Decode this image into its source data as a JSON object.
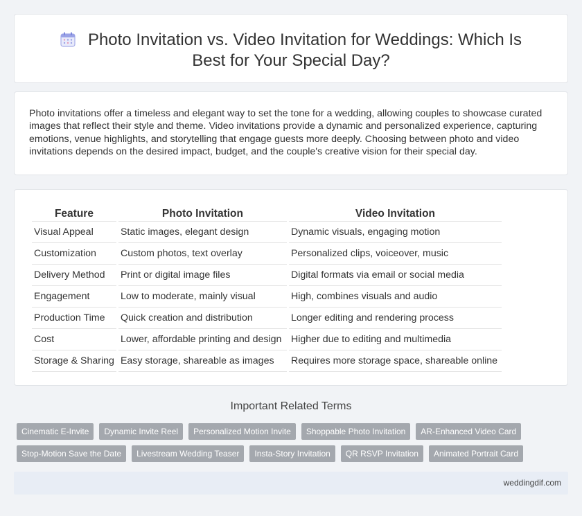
{
  "header": {
    "title": "Photo Invitation vs. Video Invitation for Weddings: Which Is Best for Your Special Day?",
    "icon": "calendar-icon"
  },
  "intro": {
    "text": "Photo invitations offer a timeless and elegant way to set the tone for a wedding, allowing couples to showcase curated images that reflect their style and theme. Video invitations provide a dynamic and personalized experience, capturing emotions, venue highlights, and storytelling that engage guests more deeply. Choosing between photo and video invitations depends on the desired impact, budget, and the couple's creative vision for their special day."
  },
  "comparison": {
    "headers": [
      "Feature",
      "Photo Invitation",
      "Video Invitation"
    ],
    "rows": [
      [
        "Visual Appeal",
        "Static images, elegant design",
        "Dynamic visuals, engaging motion"
      ],
      [
        "Customization",
        "Custom photos, text overlay",
        "Personalized clips, voiceover, music"
      ],
      [
        "Delivery Method",
        "Print or digital image files",
        "Digital formats via email or social media"
      ],
      [
        "Engagement",
        "Low to moderate, mainly visual",
        "High, combines visuals and audio"
      ],
      [
        "Production Time",
        "Quick creation and distribution",
        "Longer editing and rendering process"
      ],
      [
        "Cost",
        "Lower, affordable printing and design",
        "Higher due to editing and multimedia"
      ],
      [
        "Storage & Sharing",
        "Easy storage, shareable as images",
        "Requires more storage space, shareable online"
      ]
    ]
  },
  "related": {
    "heading": "Important Related Terms",
    "tags": [
      "Cinematic E-Invite",
      "Dynamic Invite Reel",
      "Personalized Motion Invite",
      "Shoppable Photo Invitation",
      "AR-Enhanced Video Card",
      "Stop-Motion Save the Date",
      "Livestream Wedding Teaser",
      "Insta-Story Invitation",
      "QR RSVP Invitation",
      "Animated Portrait Card"
    ]
  },
  "footer": {
    "site": "weddingdif.com"
  },
  "colors": {
    "page_background": "#f1f3f6",
    "tag_background": "#a4a8ae",
    "footer_background": "#e8edf5",
    "icon_accent": "#8a93e0"
  }
}
